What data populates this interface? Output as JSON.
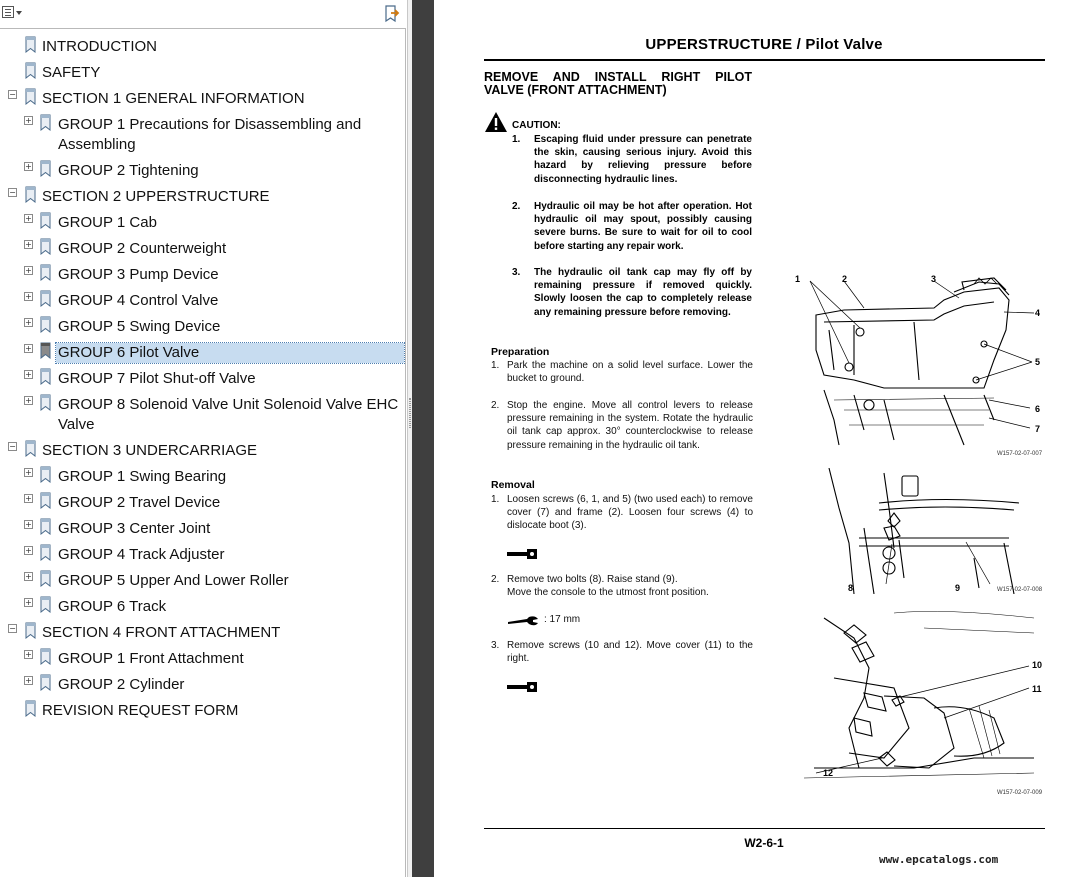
{
  "bookmarks": {
    "toolbar": {
      "options_icon": "options-icon",
      "expand_icon": "expand-bookmark-icon"
    },
    "items": [
      {
        "label": "INTRODUCTION",
        "level": 0,
        "toggle": ""
      },
      {
        "label": "SAFETY",
        "level": 0,
        "toggle": ""
      },
      {
        "label": "SECTION 1 GENERAL INFORMATION",
        "level": 0,
        "toggle": "−"
      },
      {
        "label": "GROUP 1 Precautions for Disassembling and",
        "label2": "Assembling",
        "level": 1,
        "toggle": "+"
      },
      {
        "label": "GROUP 2 Tightening",
        "level": 1,
        "toggle": "+"
      },
      {
        "label": "SECTION 2 UPPERSTRUCTURE",
        "level": 0,
        "toggle": "−"
      },
      {
        "label": "GROUP 1 Cab",
        "level": 1,
        "toggle": "+"
      },
      {
        "label": "GROUP 2 Counterweight",
        "level": 1,
        "toggle": "+"
      },
      {
        "label": "GROUP 3 Pump Device",
        "level": 1,
        "toggle": "+"
      },
      {
        "label": "GROUP 4 Control Valve",
        "level": 1,
        "toggle": "+"
      },
      {
        "label": "GROUP 5 Swing Device",
        "level": 1,
        "toggle": "+"
      },
      {
        "label": "GROUP 6 Pilot Valve",
        "level": 1,
        "toggle": "+",
        "selected": true
      },
      {
        "label": "GROUP 7 Pilot Shut-off Valve",
        "level": 1,
        "toggle": "+"
      },
      {
        "label": "GROUP 8 Solenoid Valve Unit  Solenoid Valve  EHC",
        "label2": "Valve",
        "level": 1,
        "toggle": "+"
      },
      {
        "label": "SECTION 3 UNDERCARRIAGE",
        "level": 0,
        "toggle": "−"
      },
      {
        "label": "GROUP 1 Swing Bearing",
        "level": 1,
        "toggle": "+"
      },
      {
        "label": "GROUP 2 Travel Device",
        "level": 1,
        "toggle": "+"
      },
      {
        "label": "GROUP 3 Center Joint",
        "level": 1,
        "toggle": "+"
      },
      {
        "label": "GROUP 4 Track Adjuster",
        "level": 1,
        "toggle": "+"
      },
      {
        "label": "GROUP 5 Upper And Lower Roller",
        "level": 1,
        "toggle": "+"
      },
      {
        "label": "GROUP 6 Track",
        "level": 1,
        "toggle": "+"
      },
      {
        "label": "SECTION 4 FRONT ATTACHMENT",
        "level": 0,
        "toggle": "−"
      },
      {
        "label": "GROUP 1 Front Attachment",
        "level": 1,
        "toggle": "+"
      },
      {
        "label": "GROUP 2 Cylinder",
        "level": 1,
        "toggle": "+"
      },
      {
        "label": "REVISION REQUEST FORM",
        "level": 0,
        "toggle": ""
      }
    ]
  },
  "page": {
    "header": "UPPERSTRUCTURE / Pilot Valve",
    "section_title_line1": "REMOVE AND INSTALL RIGHT PILOT",
    "section_title_line2": "VALVE (FRONT ATTACHMENT)",
    "caution": {
      "label": "CAUTION:",
      "items": [
        {
          "n": "1.",
          "text": "Escaping fluid under pressure can penetrate the skin, causing serious injury. Avoid this hazard by relieving pressure before disconnecting hydraulic lines."
        },
        {
          "n": "2.",
          "text": "Hydraulic oil may be hot after operation. Hot hydraulic oil may spout, possibly causing severe burns. Be sure to wait for oil to cool before starting any repair work."
        },
        {
          "n": "3.",
          "text": "The hydraulic oil tank cap may fly off by remaining pressure if removed quickly. Slowly loosen the cap to completely release any remaining pressure before removing."
        }
      ]
    },
    "preparation": {
      "heading": "Preparation",
      "steps": [
        {
          "n": "1.",
          "text": "Park the machine on a solid level surface. Lower the bucket to ground."
        },
        {
          "n": "2.",
          "text": "Stop the engine. Move all control levers to release pressure remaining in the system. Rotate the hydraulic oil tank cap approx. 30° counterclockwise to release pressure remaining in the hydraulic oil tank."
        }
      ]
    },
    "removal": {
      "heading": "Removal",
      "steps": [
        {
          "n": "1.",
          "text": "Loosen screws (6, 1, and 5) (two used each) to remove cover (7) and frame (2). Loosen four screws (4) to dislocate boot (3)."
        },
        {
          "n": "2.",
          "text": "Remove two bolts (8). Raise stand (9).",
          "text2": "Move the console to the utmost front position."
        },
        {
          "n": "3.",
          "text": "Remove screws (10 and 12). Move cover (11) to the right."
        }
      ],
      "wrench_size": ":  17 mm",
      "tool_icon": "hex-wrench-icon",
      "spanner_icon": "spanner-icon"
    },
    "figures": [
      {
        "code": "W157-02-07-007",
        "callouts": [
          "1",
          "2",
          "3",
          "4",
          "5",
          "6",
          "7"
        ]
      },
      {
        "code": "W157-02-07-008",
        "callouts": [
          "8",
          "9"
        ]
      },
      {
        "code": "W157-02-07-009",
        "callouts": [
          "10",
          "11",
          "12"
        ]
      }
    ],
    "page_number": "W2-6-1",
    "watermark": "www.epcatalogs.com"
  }
}
